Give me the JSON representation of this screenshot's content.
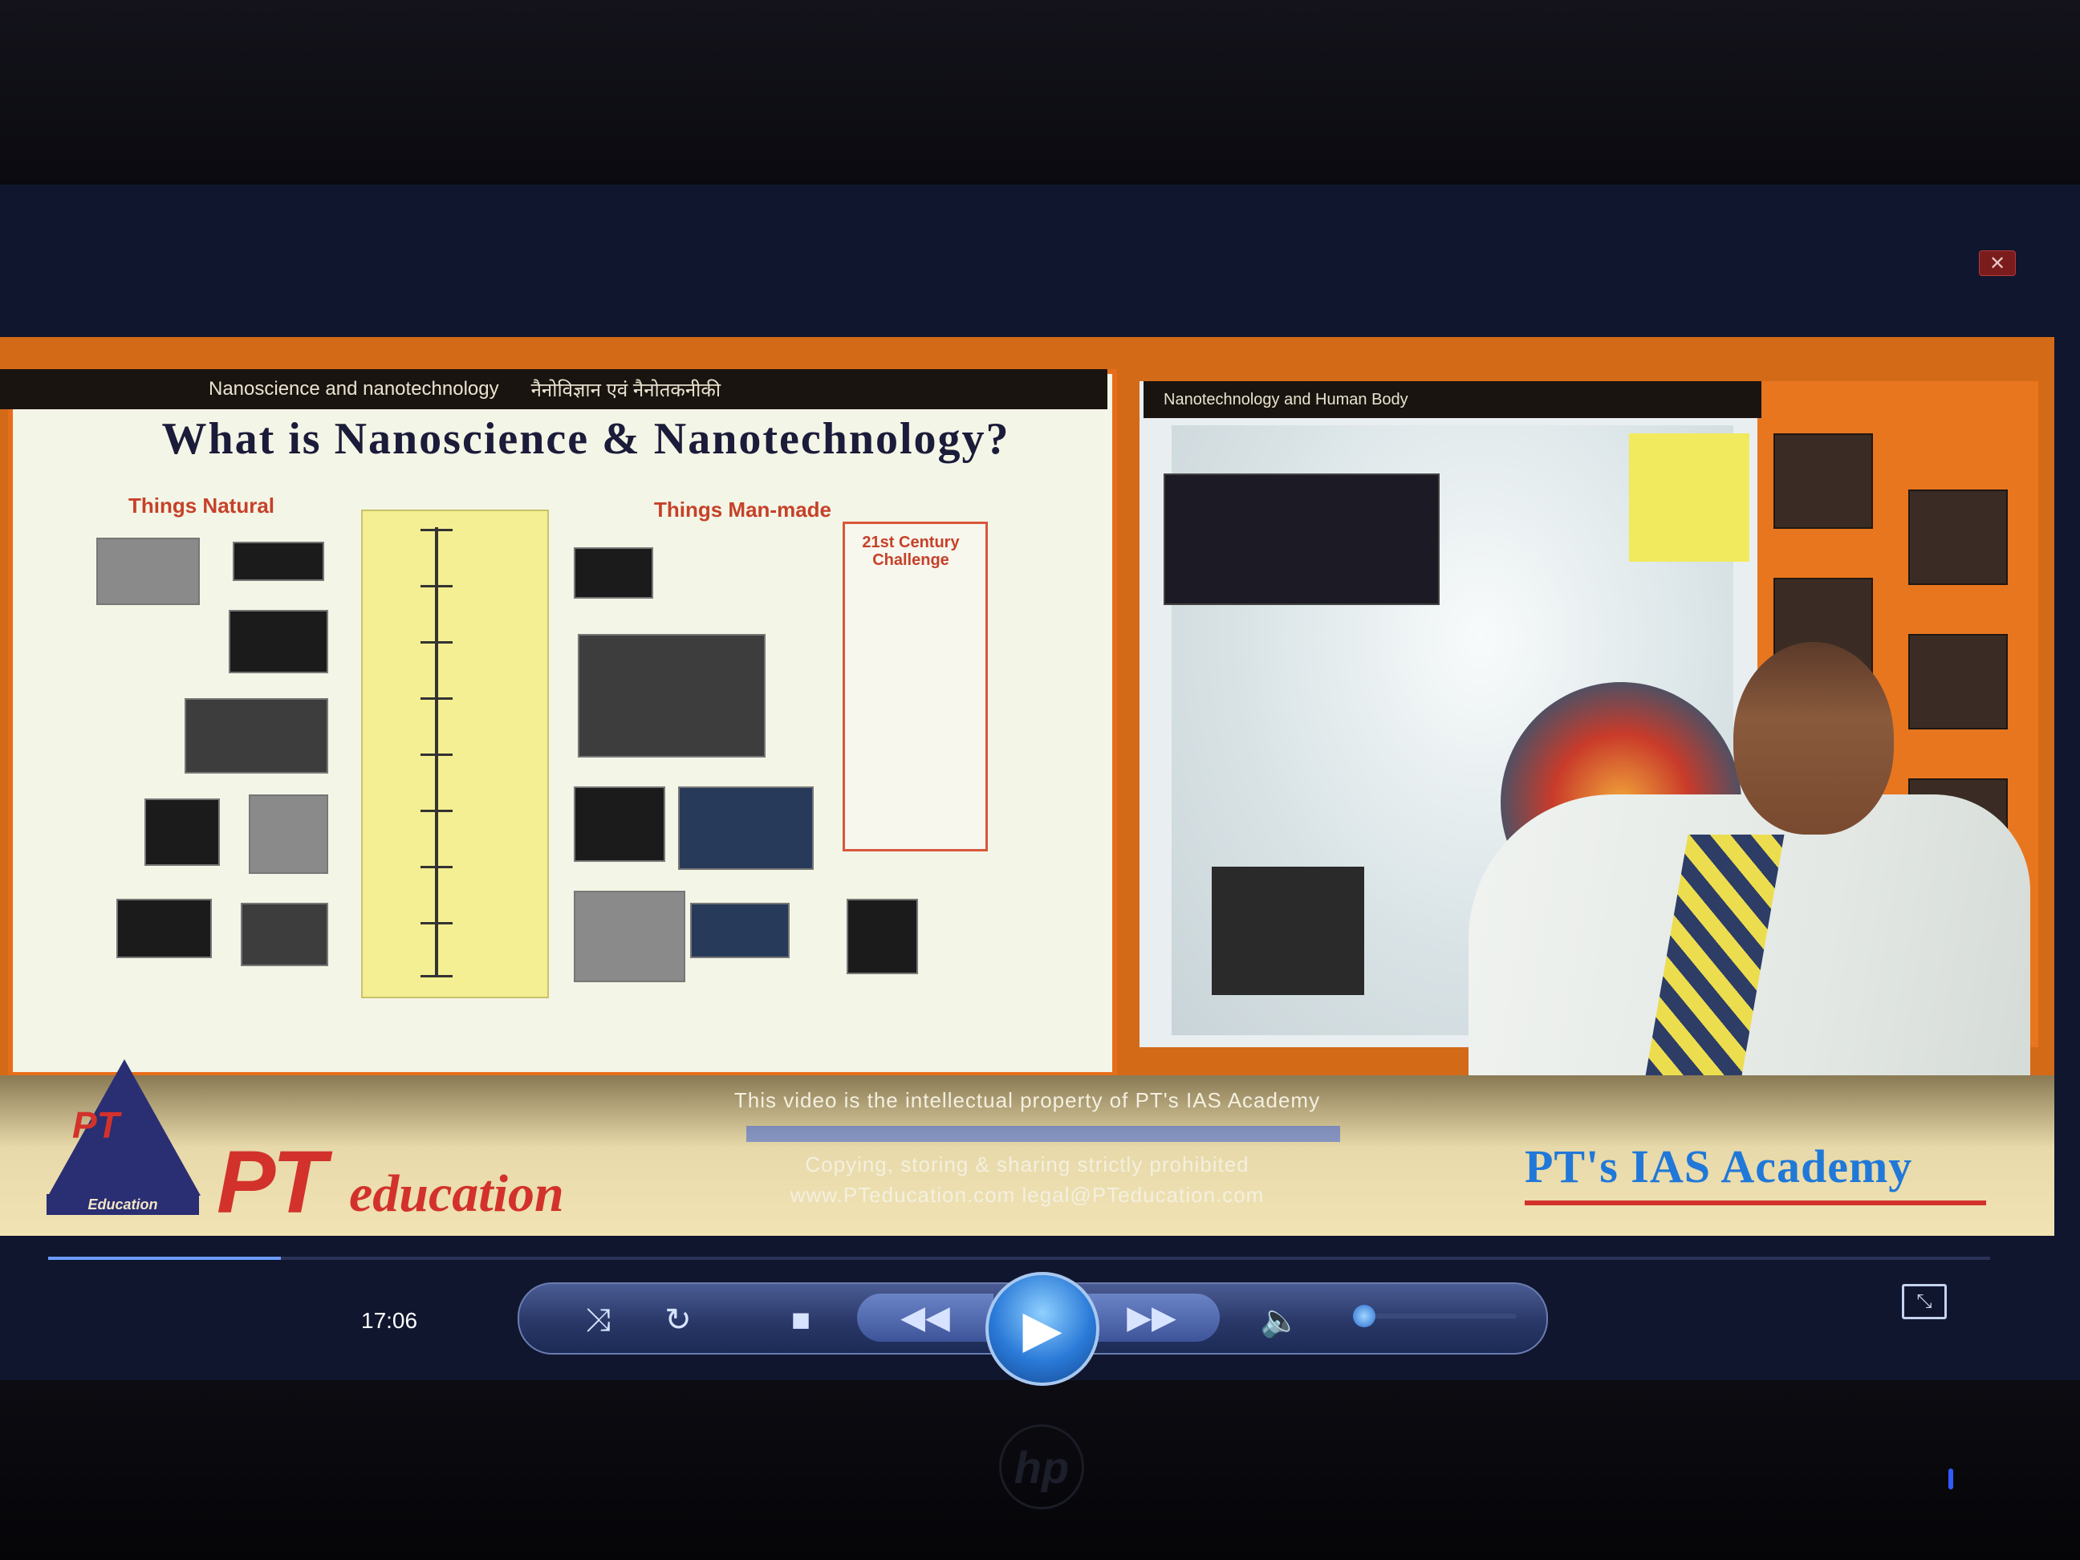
{
  "window": {
    "close_label": "✕"
  },
  "slide_left": {
    "header_en": "Nanoscience and nanotechnology",
    "header_hi": "नैनोविज्ञान एवं नैनोतकनीकी",
    "title": "What is Nanoscience & Nanotechnology?",
    "natural_label": "Things Natural",
    "manmade_label": "Things Man-made",
    "challenge_label": "21st Century Challenge"
  },
  "slide_right": {
    "header_en": "Nanotechnology and Human Body"
  },
  "banner": {
    "logo_small": "Education",
    "logo_triangle": "PT",
    "brand_pt": "PT",
    "brand_education": "education",
    "notice_line1": "This video is the intellectual property of PT's IAS Academy",
    "notice_line3": "Copying, storing & sharing strictly prohibited",
    "notice_line4": "www.PTeducation.com  legal@PTeducation.com",
    "academy_name": "PT's IAS Academy"
  },
  "player": {
    "time": "17:06",
    "progress_fraction": 0.12,
    "volume_fraction": 0.05,
    "icons": {
      "shuffle": "⤨",
      "repeat": "↻",
      "stop": "■",
      "prev": "◀◀",
      "play": "▶",
      "next": "▶▶",
      "mute": "🔈",
      "fullscreen": "⤡"
    }
  },
  "colors": {
    "slide_border": "#e86d1a",
    "brand_red": "#d2322b",
    "academy_blue": "#2078d8",
    "player_bar": "#2a3868"
  }
}
